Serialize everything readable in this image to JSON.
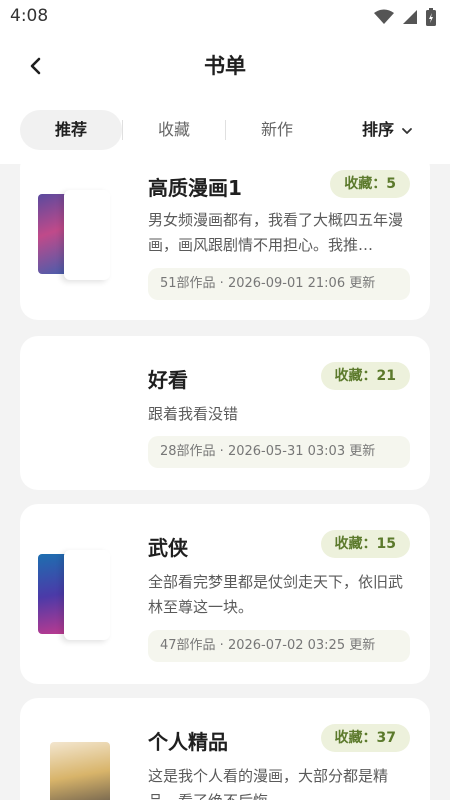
{
  "status": {
    "time": "4:08"
  },
  "header": {
    "title": "书单"
  },
  "tabs": [
    {
      "label": "推荐",
      "active": true
    },
    {
      "label": "收藏",
      "active": false
    },
    {
      "label": "新作",
      "active": false
    },
    {
      "label": "排序",
      "active": false
    }
  ],
  "booklists": [
    {
      "title": "高质漫画1",
      "favorites": "收藏：5",
      "description": "男女频漫画都有，我看了大概四五年漫画，画风跟剧情不用担心。我推…",
      "meta": "51部作品 · 2026-09-01 21:06 更新"
    },
    {
      "title": "好看",
      "favorites": "收藏：21",
      "description": "跟着我看没错",
      "meta": "28部作品 · 2026-05-31 03:03 更新"
    },
    {
      "title": "武侠",
      "favorites": "收藏：15",
      "description": "全部看完梦里都是仗剑走天下，依旧武林至尊这一块。",
      "meta": "47部作品 · 2026-07-02 03:25 更新"
    },
    {
      "title": "个人精品",
      "favorites": "收藏：37",
      "description": "这是我个人看的漫画，大部分都是精品，看了绝不后悔。",
      "meta": ""
    }
  ],
  "colors": {
    "badge_bg": "#edf1dc",
    "badge_text": "#5c7a2c",
    "meta_bg": "#f5f6ee"
  }
}
